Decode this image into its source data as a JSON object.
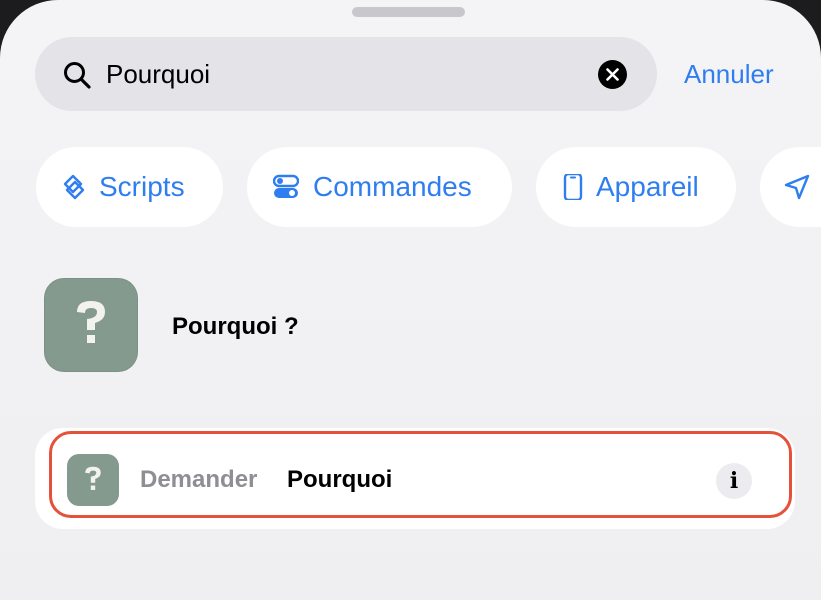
{
  "search": {
    "value": "Pourquoi",
    "cancel_label": "Annuler"
  },
  "filters": [
    {
      "label": "Scripts",
      "icon": "scripts-icon"
    },
    {
      "label": "Commandes",
      "icon": "toggles-icon"
    },
    {
      "label": "Appareil",
      "icon": "iphone-icon"
    },
    {
      "label": "",
      "icon": "location-arrow-icon"
    }
  ],
  "result": {
    "app_name": "Pourquoi ?",
    "icon": "question-mark-app-icon"
  },
  "action": {
    "verb": "Demander",
    "object": "Pourquoi",
    "info_symbol": "i"
  },
  "colors": {
    "accent": "#2f7ef0",
    "app_icon": "#849a8e",
    "highlight": "#e5513a"
  }
}
